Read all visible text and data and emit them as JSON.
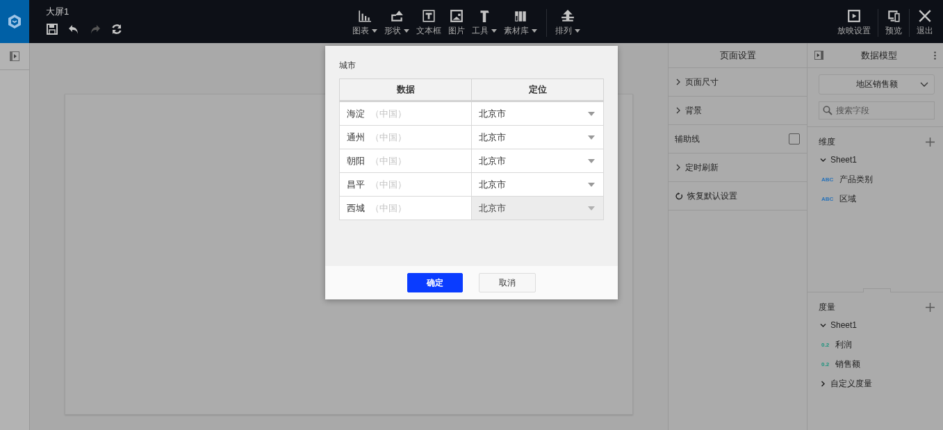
{
  "top_bar": {
    "title": "大屏1",
    "file_actions": [
      {
        "kind": "save",
        "disabled": false
      },
      {
        "kind": "undo",
        "disabled": false
      },
      {
        "kind": "redo",
        "disabled": true
      },
      {
        "kind": "refresh",
        "disabled": false
      }
    ],
    "tools": [
      {
        "kind": "chart",
        "label": "图表",
        "dropdown": true
      },
      {
        "kind": "shape",
        "label": "形状",
        "dropdown": true
      },
      {
        "kind": "textbox",
        "label": "文本框",
        "dropdown": false
      },
      {
        "kind": "image",
        "label": "图片",
        "dropdown": false
      },
      {
        "kind": "tools",
        "label": "工具",
        "dropdown": true
      },
      {
        "kind": "library",
        "label": "素材库",
        "dropdown": true
      },
      {
        "kind": "arrange",
        "label": "排列",
        "dropdown": true
      }
    ],
    "right_actions": [
      {
        "kind": "play",
        "label": "放映设置"
      },
      {
        "kind": "preview",
        "label": "预览"
      },
      {
        "kind": "exit",
        "label": "退出"
      }
    ]
  },
  "dialog": {
    "field_label": "城市",
    "columns": [
      "数据",
      "定位"
    ],
    "rows": [
      {
        "name": "海淀",
        "country": "（中国）",
        "location": "北京市",
        "highlighted": false
      },
      {
        "name": "通州",
        "country": "（中国）",
        "location": "北京市",
        "highlighted": false
      },
      {
        "name": "朝阳",
        "country": "（中国）",
        "location": "北京市",
        "highlighted": false
      },
      {
        "name": "昌平",
        "country": "（中国）",
        "location": "北京市",
        "highlighted": false
      },
      {
        "name": "西城",
        "country": "（中国）",
        "location": "北京市",
        "highlighted": true
      }
    ],
    "buttons": [
      {
        "kind": "primary",
        "label": "确定"
      },
      {
        "kind": "secondary",
        "label": "取消"
      }
    ]
  },
  "page_settings": {
    "title": "页面设置",
    "items": [
      {
        "kind": "expand",
        "label": "页面尺寸"
      },
      {
        "kind": "expand",
        "label": "背景"
      },
      {
        "kind": "checkbox",
        "label": "辅助线",
        "checked": false
      },
      {
        "kind": "expand",
        "label": "定时刷新"
      },
      {
        "kind": "reset",
        "label": "恢复默认设置"
      }
    ]
  },
  "data_model": {
    "title": "数据模型",
    "dataset": "地区销售额",
    "search": {
      "placeholder": "搜索字段"
    },
    "sections": [
      {
        "title": "维度",
        "groups": [
          {
            "name": "Sheet1",
            "expanded": true,
            "children": [
              {
                "kind": "text",
                "badge": "ABC",
                "name": "产品类别"
              },
              {
                "kind": "text",
                "badge": "ABC",
                "name": "区域"
              }
            ]
          }
        ]
      },
      {
        "title": "度量",
        "groups": [
          {
            "name": "Sheet1",
            "expanded": true,
            "children": [
              {
                "kind": "number",
                "badge": "0.2",
                "name": "利润"
              },
              {
                "kind": "number",
                "badge": "0.2",
                "name": "销售额"
              }
            ]
          },
          {
            "name": "自定义度量",
            "expanded": false
          }
        ]
      }
    ]
  }
}
